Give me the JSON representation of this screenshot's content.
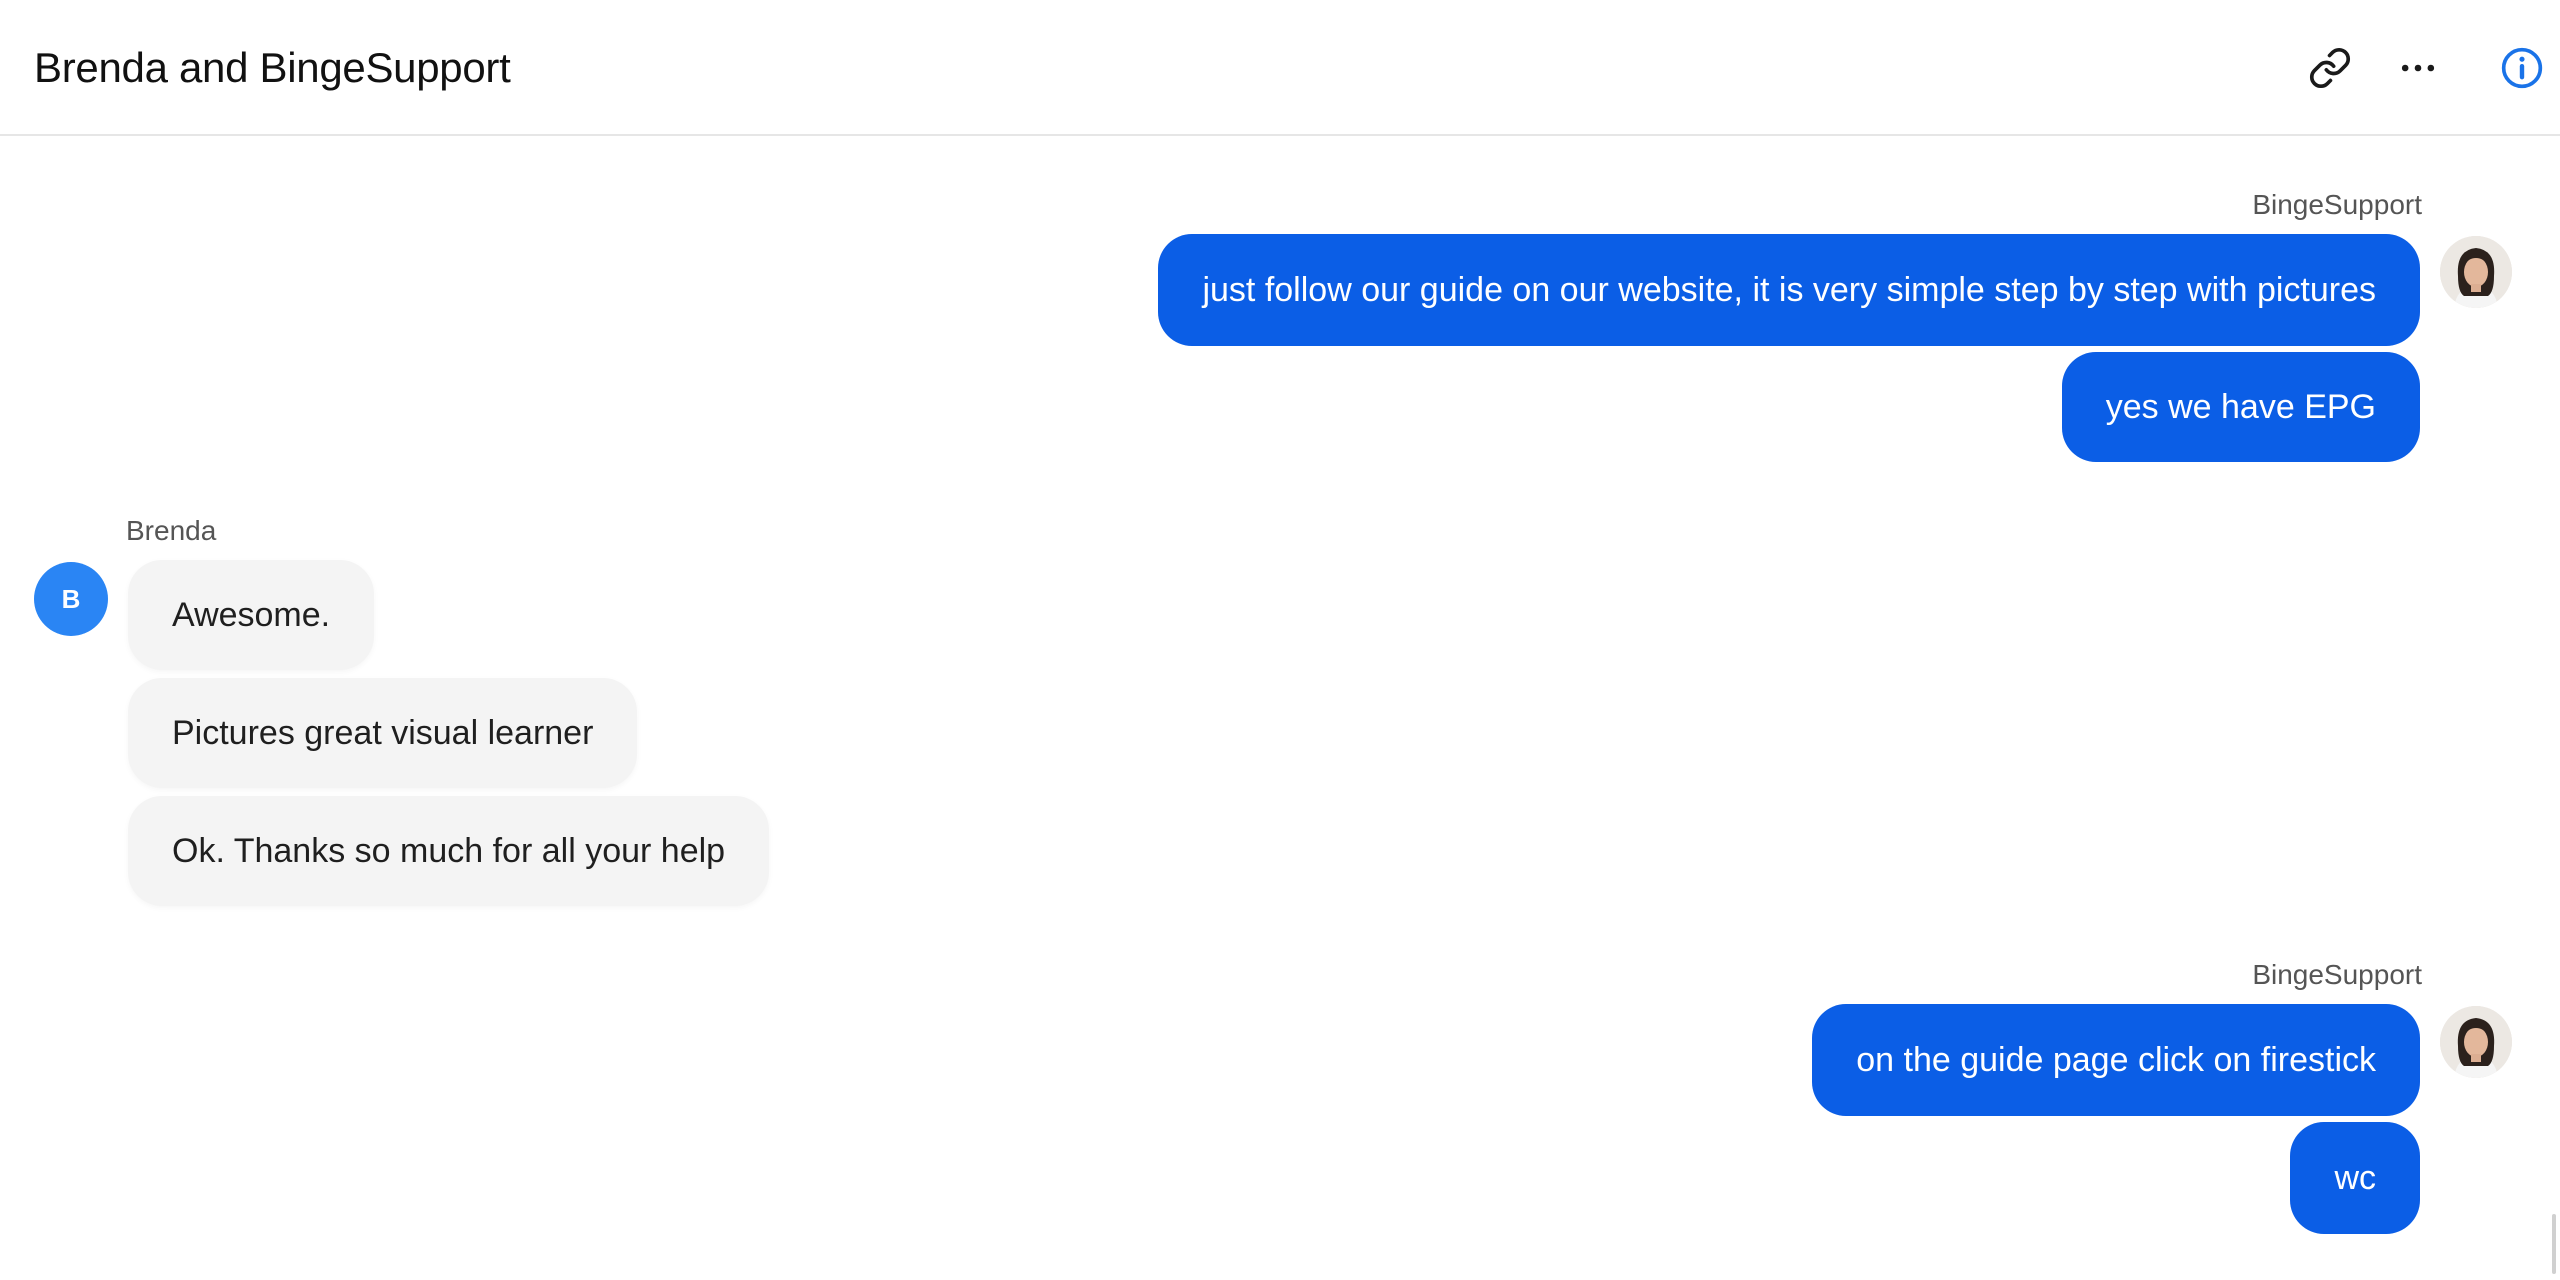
{
  "header": {
    "title": "Brenda and BingeSupport",
    "icons": [
      "link-icon",
      "more-icon",
      "info-icon"
    ]
  },
  "colors": {
    "outgoing_bubble": "#0b5ee6",
    "incoming_bubble": "#f4f4f4",
    "customer_avatar": "#2a85f4",
    "info_icon": "#1a73e8"
  },
  "conversation": {
    "group1": {
      "sender": "BingeSupport",
      "messages": [
        "just follow our guide on our website, it is very simple step by step with pictures",
        "yes we have EPG"
      ]
    },
    "group2": {
      "sender": "Brenda",
      "avatar_initial": "B",
      "messages": [
        "Awesome.",
        "Pictures great visual learner",
        "Ok. Thanks so much for all your help"
      ]
    },
    "group3": {
      "sender": "BingeSupport",
      "messages": [
        "on the guide page click on firestick",
        "wc"
      ]
    }
  }
}
